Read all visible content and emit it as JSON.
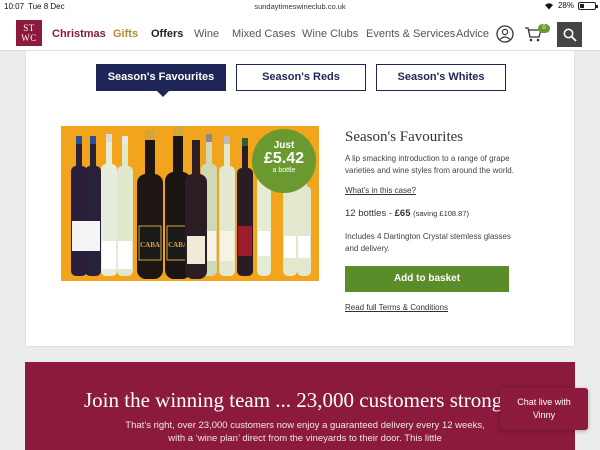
{
  "status_bar": {
    "time": "10:07",
    "date": "Tue 8 Dec",
    "url": "sundaytimeswineclub.co.uk",
    "battery": "28%"
  },
  "nav": {
    "logo_line1": "ST",
    "logo_line2": "WC",
    "links": [
      "Christmas",
      "Gifts",
      "Offers",
      "Wine",
      "Mixed Cases",
      "Wine Clubs",
      "Events & Services",
      "Advice"
    ],
    "basket_count": "0"
  },
  "tabs": [
    "Season's Favourites",
    "Season's Reds",
    "Season's Whites"
  ],
  "product": {
    "badge_just": "Just",
    "badge_price": "£5.42",
    "badge_per": "a bottle",
    "title": "Season's Favourites",
    "description": "A lip smacking introduction to a range of grape varieties and wine styles from around the world.",
    "whats_in_case": "What's in this case?",
    "bottles": "12 bottles - ",
    "price": "£65",
    "saving": "(saving £108.87)",
    "includes": "Includes 4 Dartington Crystal stemless glasses and delivery.",
    "add_to_basket": "Add to basket",
    "terms": "Read full Terms & Conditions"
  },
  "promo": {
    "heading": "Join the winning team ... 23,000 customers strong",
    "text": "That’s right, over 23,000 customers now enjoy a guaranteed delivery every 12 weeks, with a ‘wine plan’ direct from the vineyards to their door. This little"
  },
  "chat": {
    "line1": "Chat live with",
    "line2": "Vinny"
  },
  "colors": {
    "brand": "#8b1a3c",
    "navy": "#1e2657",
    "green": "#5b8c2a",
    "image_bg": "#f2a51c"
  }
}
